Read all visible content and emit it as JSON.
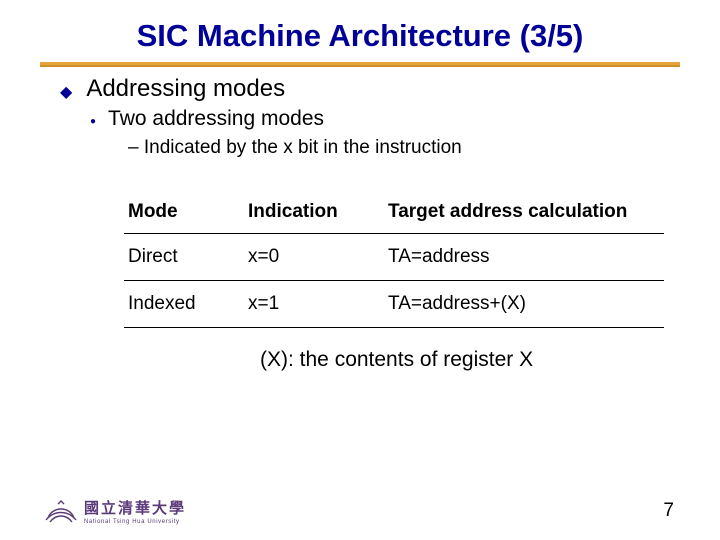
{
  "title": "SIC Machine Architecture (3/5)",
  "bullets": {
    "l1": "Addressing modes",
    "l2": "Two addressing modes",
    "l3": "– Indicated by the x bit in the instruction"
  },
  "table": {
    "headers": {
      "mode": "Mode",
      "indication": "Indication",
      "target": "Target address calculation"
    },
    "rows": [
      {
        "mode": "Direct",
        "indication": "x=0",
        "target": "TA=address"
      },
      {
        "mode": "Indexed",
        "indication": "x=1",
        "target": "TA=address+(X)"
      }
    ]
  },
  "note": "(X): the contents of register X",
  "footer": {
    "cn": "國立清華大學",
    "en": "National Tsing Hua University"
  },
  "page": "7"
}
